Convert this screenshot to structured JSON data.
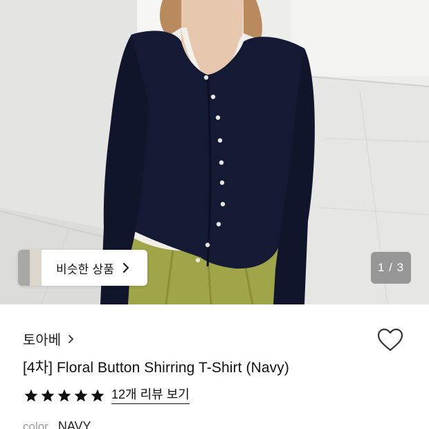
{
  "hero": {
    "similar_button_label": "비슷한 상품",
    "page_counter": "1 / 3"
  },
  "product": {
    "brand": "토아베",
    "title": "[4차] Floral Button Shirring T-Shirt (Navy)",
    "rating": 5,
    "review_link": "12개 리뷰 보기",
    "color_label": "color",
    "color_value": "NAVY"
  },
  "colors": {
    "star": "#111111",
    "heart_stroke": "#333333",
    "counter_bg": "#7a7a7a",
    "cardigan": "#141a33",
    "skirt": "#9fa548"
  },
  "icons": {
    "similar_chevron": "chevron-right-icon",
    "brand_chevron": "chevron-right-icon",
    "wishlist": "heart-outline-icon",
    "star": "star-filled-icon"
  }
}
